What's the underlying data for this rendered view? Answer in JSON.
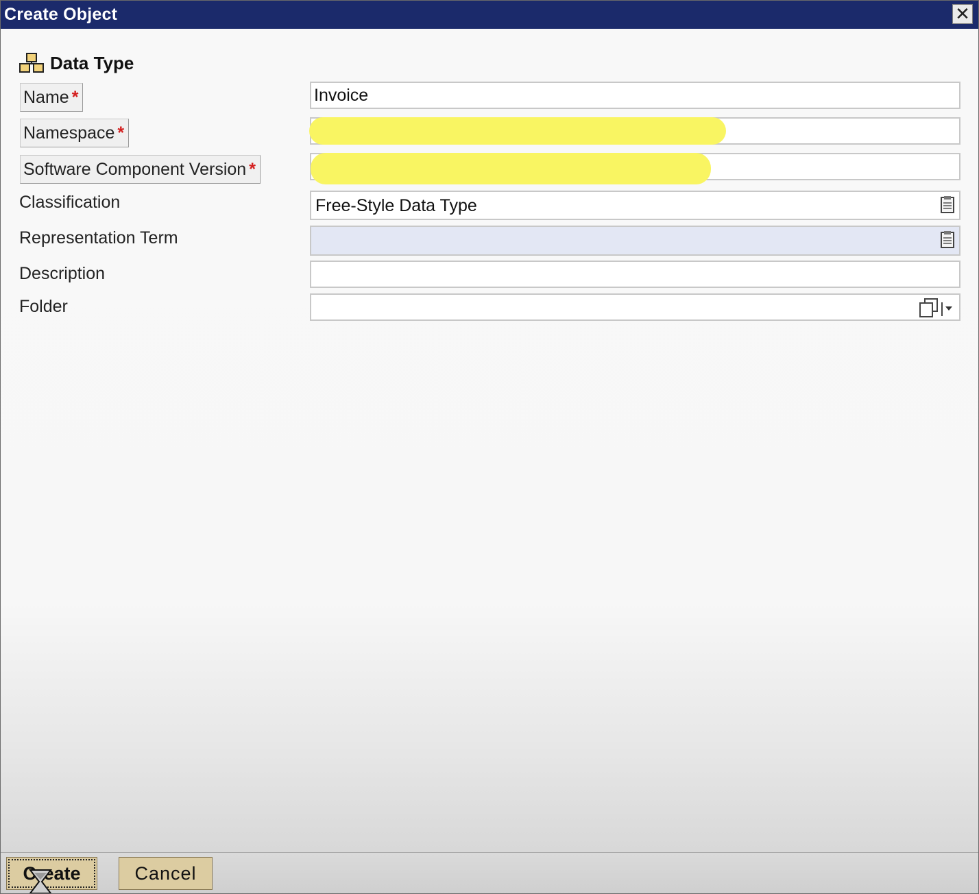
{
  "window": {
    "title": "Create Object",
    "close_symbol": "✕"
  },
  "object_type": {
    "icon": "data-type-icon",
    "label": "Data Type"
  },
  "form": {
    "fields": {
      "name": {
        "label": "Name",
        "required_marker": "*",
        "value": "Invoice"
      },
      "namespace": {
        "label": "Namespace",
        "required_marker": "*",
        "value": ""
      },
      "software_component_version": {
        "label": "Software Component Version",
        "required_marker": "*",
        "value": ""
      },
      "classification": {
        "label": "Classification",
        "value": "Free-Style Data Type",
        "icon": "value-help-icon"
      },
      "representation_term": {
        "label": "Representation Term",
        "value": "",
        "icon": "value-help-icon"
      },
      "description": {
        "label": "Description",
        "value": ""
      },
      "folder": {
        "label": "Folder",
        "value": "",
        "icon": "folder-select-icon"
      }
    }
  },
  "footer": {
    "create_label": "Create",
    "cancel_label": "Cancel"
  },
  "colors": {
    "titlebar": "#1b2a6b",
    "required_marker": "#d42020",
    "button": "#dccca1",
    "readonly_field": "#e3e7f4",
    "redaction": "#f9f562"
  }
}
